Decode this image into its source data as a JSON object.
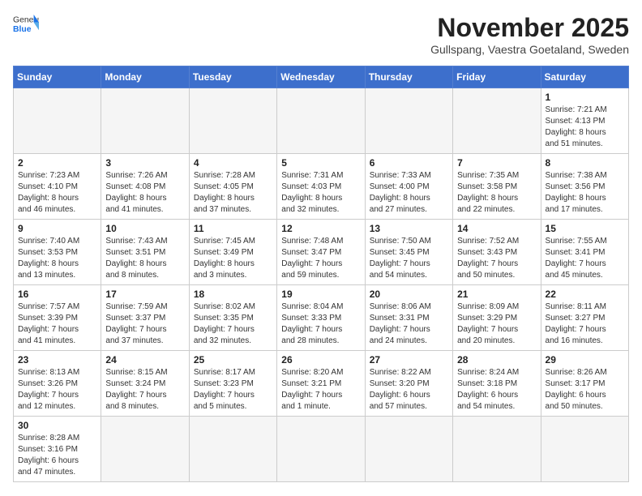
{
  "header": {
    "logo_general": "General",
    "logo_blue": "Blue",
    "month_title": "November 2025",
    "location": "Gullspang, Vaestra Goetaland, Sweden"
  },
  "weekdays": [
    "Sunday",
    "Monday",
    "Tuesday",
    "Wednesday",
    "Thursday",
    "Friday",
    "Saturday"
  ],
  "weeks": [
    [
      {
        "day": "",
        "info": ""
      },
      {
        "day": "",
        "info": ""
      },
      {
        "day": "",
        "info": ""
      },
      {
        "day": "",
        "info": ""
      },
      {
        "day": "",
        "info": ""
      },
      {
        "day": "",
        "info": ""
      },
      {
        "day": "1",
        "info": "Sunrise: 7:21 AM\nSunset: 4:13 PM\nDaylight: 8 hours\nand 51 minutes."
      }
    ],
    [
      {
        "day": "2",
        "info": "Sunrise: 7:23 AM\nSunset: 4:10 PM\nDaylight: 8 hours\nand 46 minutes."
      },
      {
        "day": "3",
        "info": "Sunrise: 7:26 AM\nSunset: 4:08 PM\nDaylight: 8 hours\nand 41 minutes."
      },
      {
        "day": "4",
        "info": "Sunrise: 7:28 AM\nSunset: 4:05 PM\nDaylight: 8 hours\nand 37 minutes."
      },
      {
        "day": "5",
        "info": "Sunrise: 7:31 AM\nSunset: 4:03 PM\nDaylight: 8 hours\nand 32 minutes."
      },
      {
        "day": "6",
        "info": "Sunrise: 7:33 AM\nSunset: 4:00 PM\nDaylight: 8 hours\nand 27 minutes."
      },
      {
        "day": "7",
        "info": "Sunrise: 7:35 AM\nSunset: 3:58 PM\nDaylight: 8 hours\nand 22 minutes."
      },
      {
        "day": "8",
        "info": "Sunrise: 7:38 AM\nSunset: 3:56 PM\nDaylight: 8 hours\nand 17 minutes."
      }
    ],
    [
      {
        "day": "9",
        "info": "Sunrise: 7:40 AM\nSunset: 3:53 PM\nDaylight: 8 hours\nand 13 minutes."
      },
      {
        "day": "10",
        "info": "Sunrise: 7:43 AM\nSunset: 3:51 PM\nDaylight: 8 hours\nand 8 minutes."
      },
      {
        "day": "11",
        "info": "Sunrise: 7:45 AM\nSunset: 3:49 PM\nDaylight: 8 hours\nand 3 minutes."
      },
      {
        "day": "12",
        "info": "Sunrise: 7:48 AM\nSunset: 3:47 PM\nDaylight: 7 hours\nand 59 minutes."
      },
      {
        "day": "13",
        "info": "Sunrise: 7:50 AM\nSunset: 3:45 PM\nDaylight: 7 hours\nand 54 minutes."
      },
      {
        "day": "14",
        "info": "Sunrise: 7:52 AM\nSunset: 3:43 PM\nDaylight: 7 hours\nand 50 minutes."
      },
      {
        "day": "15",
        "info": "Sunrise: 7:55 AM\nSunset: 3:41 PM\nDaylight: 7 hours\nand 45 minutes."
      }
    ],
    [
      {
        "day": "16",
        "info": "Sunrise: 7:57 AM\nSunset: 3:39 PM\nDaylight: 7 hours\nand 41 minutes."
      },
      {
        "day": "17",
        "info": "Sunrise: 7:59 AM\nSunset: 3:37 PM\nDaylight: 7 hours\nand 37 minutes."
      },
      {
        "day": "18",
        "info": "Sunrise: 8:02 AM\nSunset: 3:35 PM\nDaylight: 7 hours\nand 32 minutes."
      },
      {
        "day": "19",
        "info": "Sunrise: 8:04 AM\nSunset: 3:33 PM\nDaylight: 7 hours\nand 28 minutes."
      },
      {
        "day": "20",
        "info": "Sunrise: 8:06 AM\nSunset: 3:31 PM\nDaylight: 7 hours\nand 24 minutes."
      },
      {
        "day": "21",
        "info": "Sunrise: 8:09 AM\nSunset: 3:29 PM\nDaylight: 7 hours\nand 20 minutes."
      },
      {
        "day": "22",
        "info": "Sunrise: 8:11 AM\nSunset: 3:27 PM\nDaylight: 7 hours\nand 16 minutes."
      }
    ],
    [
      {
        "day": "23",
        "info": "Sunrise: 8:13 AM\nSunset: 3:26 PM\nDaylight: 7 hours\nand 12 minutes."
      },
      {
        "day": "24",
        "info": "Sunrise: 8:15 AM\nSunset: 3:24 PM\nDaylight: 7 hours\nand 8 minutes."
      },
      {
        "day": "25",
        "info": "Sunrise: 8:17 AM\nSunset: 3:23 PM\nDaylight: 7 hours\nand 5 minutes."
      },
      {
        "day": "26",
        "info": "Sunrise: 8:20 AM\nSunset: 3:21 PM\nDaylight: 7 hours\nand 1 minute."
      },
      {
        "day": "27",
        "info": "Sunrise: 8:22 AM\nSunset: 3:20 PM\nDaylight: 6 hours\nand 57 minutes."
      },
      {
        "day": "28",
        "info": "Sunrise: 8:24 AM\nSunset: 3:18 PM\nDaylight: 6 hours\nand 54 minutes."
      },
      {
        "day": "29",
        "info": "Sunrise: 8:26 AM\nSunset: 3:17 PM\nDaylight: 6 hours\nand 50 minutes."
      }
    ],
    [
      {
        "day": "30",
        "info": "Sunrise: 8:28 AM\nSunset: 3:16 PM\nDaylight: 6 hours\nand 47 minutes."
      },
      {
        "day": "",
        "info": ""
      },
      {
        "day": "",
        "info": ""
      },
      {
        "day": "",
        "info": ""
      },
      {
        "day": "",
        "info": ""
      },
      {
        "day": "",
        "info": ""
      },
      {
        "day": "",
        "info": ""
      }
    ]
  ]
}
